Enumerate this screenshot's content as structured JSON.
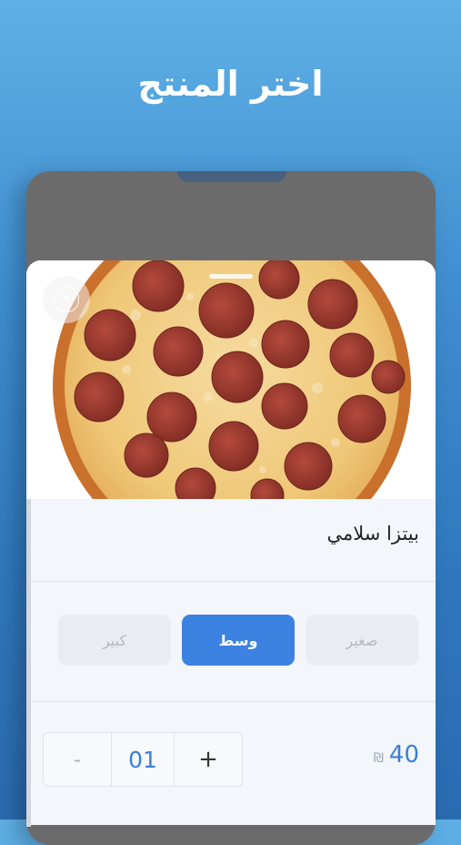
{
  "header": {
    "title": "اختر المنتج"
  },
  "product": {
    "name": "بيتزا سلامي",
    "image_alt": "pepperoni pizza"
  },
  "sizes": [
    {
      "label": "صغير",
      "selected": false
    },
    {
      "label": "وسط",
      "selected": true
    },
    {
      "label": "كبير",
      "selected": false
    }
  ],
  "quantity": {
    "minus_label": "-",
    "value": "01",
    "plus_label": "+"
  },
  "price": {
    "amount": "40",
    "currency": "₪"
  },
  "colors": {
    "accent": "#3c82e0",
    "price": "#3b7fd6"
  }
}
